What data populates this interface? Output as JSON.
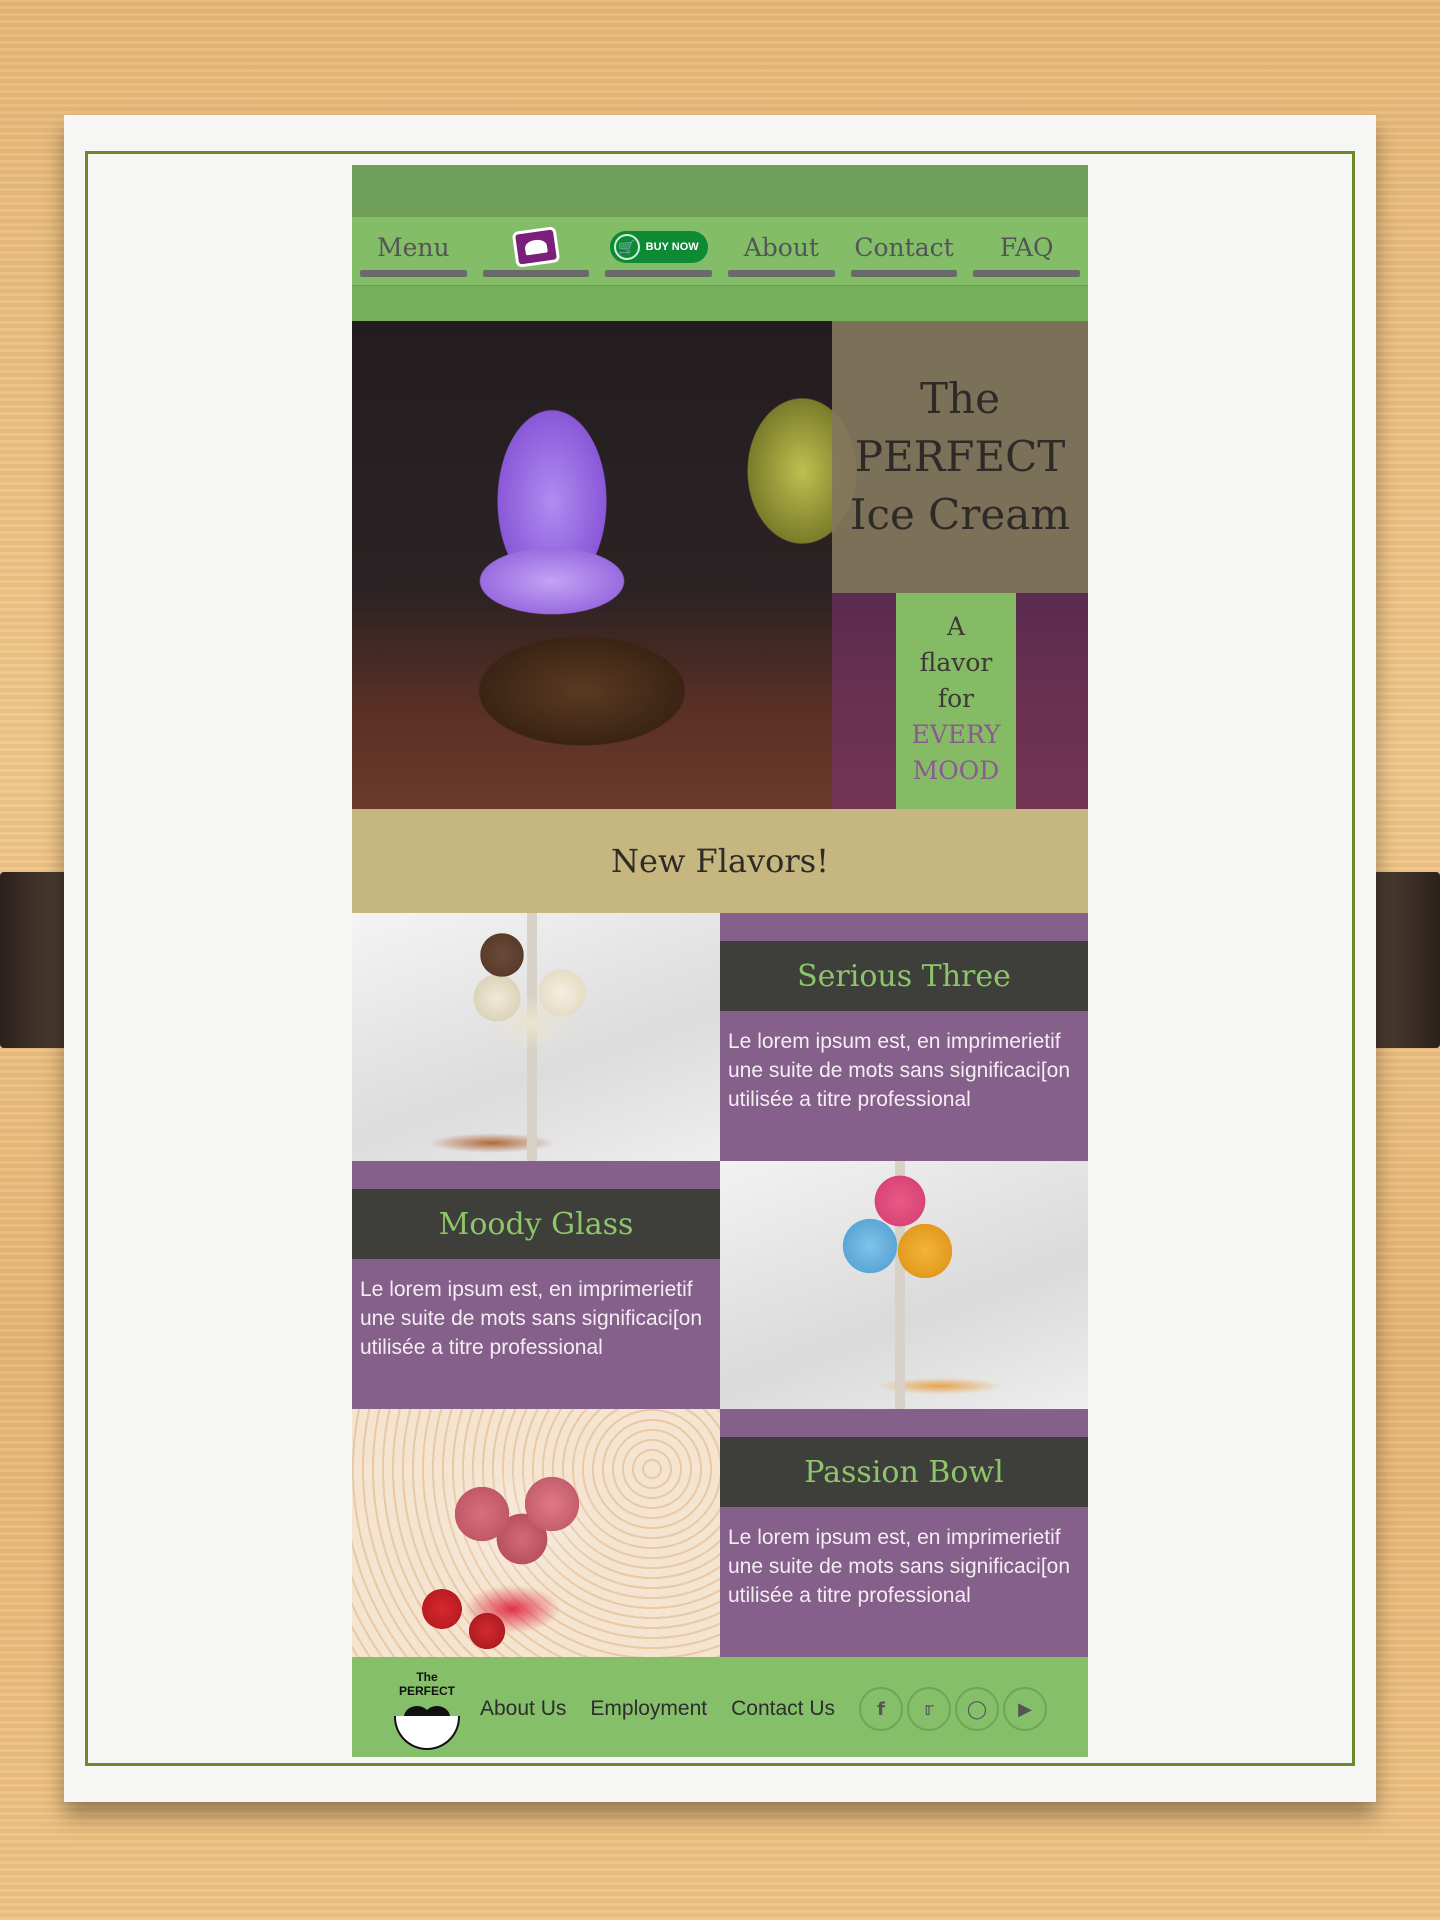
{
  "nav": {
    "items": [
      {
        "label": "Menu"
      },
      {
        "label": ""
      },
      {
        "label": "BUY NOW"
      },
      {
        "label": "About"
      },
      {
        "label": "Contact"
      },
      {
        "label": "FAQ"
      }
    ]
  },
  "hero": {
    "title_line1": "The",
    "title_line2": "PERFECT",
    "title_line3": "Ice Cream",
    "tagline_line1": "A",
    "tagline_line2": "flavor",
    "tagline_line3": "for",
    "tagline_line4": "EVERY",
    "tagline_line5": "MOOD"
  },
  "section_heading": "New Flavors!",
  "flavors": [
    {
      "name": "Serious Three",
      "description": "Le lorem ipsum est, en imprimerietif une suite de mots sans significaci[on utilisée a titre professional"
    },
    {
      "name": "Moody Glass",
      "description": "Le lorem ipsum est, en imprimerietif une suite de mots sans significaci[on utilisée a titre professional"
    },
    {
      "name": "Passion Bowl",
      "description": "Le lorem ipsum est, en imprimerietif une suite de mots sans significaci[on utilisée a titre professional"
    }
  ],
  "footer": {
    "logo_line1": "The",
    "logo_line2": "PERFECT",
    "links": [
      "About Us",
      "Employment",
      "Contact Us"
    ],
    "social_icons": [
      "facebook-icon",
      "twitter-icon",
      "instagram-icon",
      "youtube-icon"
    ]
  },
  "colors": {
    "nav_green": "#83bd67",
    "purple": "#85608a",
    "dark_header": "#3e3f3a",
    "flavor_title_green": "#8dc56b",
    "tan": "#c6b67f"
  }
}
